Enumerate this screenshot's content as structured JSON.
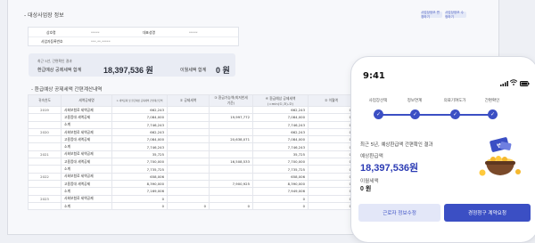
{
  "desktop": {
    "section1_title": "- 대상사업장 정보",
    "header_buttons": [
      "사업장정보 변경하기",
      "사업장정보 수정하기"
    ],
    "info_rows": [
      {
        "k1": "상호명",
        "v1": "*****",
        "k2": "대표성명",
        "v2": "*****"
      },
      {
        "k1": "사업자등록번호",
        "v1": "***-**-*****",
        "k2": "",
        "v2": ""
      }
    ],
    "summary": {
      "caption": "최근 5년, 간편확인 결과",
      "refund_label": "환급예상 공제세액 합계",
      "refund_value": "18,397,536 원",
      "carry_label": "이월세액 합계",
      "carry_value": "0 원"
    },
    "section2_title": "- 환급예상 공제세액 간편계산내역",
    "table": {
      "headers": [
        "귀속연도",
        "세액공제명",
        "① 세액공제 및 환급예상 공제세액 간편계산금액",
        "② 공제세액",
        "③ 환급가능액(최저한세 기준)",
        "④ 환급예상 공제세액 (=min(①,③)-②)",
        "⑤ 이월액",
        "⑥ 간편계산",
        "환급세액"
      ],
      "rows": [
        {
          "year": "2019",
          "name": "사회보험료 세액공제",
          "c1": "662,243",
          "c2": "",
          "c3": "",
          "c4": "662,243",
          "c5": "0",
          "c6": ""
        },
        {
          "year": "",
          "name": "고용증대 세액공제",
          "c1": "7,084,000",
          "c2": "",
          "c3": "19,997,772",
          "c4": "7,084,000",
          "c5": "0",
          "c6": ""
        },
        {
          "year": "",
          "name": "소계",
          "c1": "7,746,243",
          "c2": "",
          "c3": "",
          "c4": "7,746,243",
          "c5": "0",
          "c6": ""
        },
        {
          "year": "2020",
          "name": "사회보험료 세액공제",
          "c1": "662,243",
          "c2": "",
          "c3": "",
          "c4": "662,243",
          "c5": "0",
          "c6": ""
        },
        {
          "year": "",
          "name": "고용증대 세액공제",
          "c1": "7,084,000",
          "c2": "",
          "c3": "20,638,071",
          "c4": "7,084,000",
          "c5": "0",
          "c6": ""
        },
        {
          "year": "",
          "name": "소계",
          "c1": "7,746,243",
          "c2": "",
          "c3": "",
          "c4": "7,746,243",
          "c5": "0",
          "c6": ""
        },
        {
          "year": "2021",
          "name": "사회보험료 세액공제",
          "c1": "35,725",
          "c2": "",
          "c3": "",
          "c4": "35,725",
          "c5": "0",
          "c6": ""
        },
        {
          "year": "",
          "name": "고용증대 세액공제",
          "c1": "7,700,000",
          "c2": "",
          "c3": "16,508,533",
          "c4": "7,700,000",
          "c5": "0",
          "c6": ""
        },
        {
          "year": "",
          "name": "소계",
          "c1": "7,735,725",
          "c2": "",
          "c3": "",
          "c4": "7,735,725",
          "c5": "0",
          "c6": ""
        },
        {
          "year": "2022",
          "name": "사회보험료 세액공제",
          "c1": "658,006",
          "c2": "",
          "c3": "",
          "c4": "658,006",
          "c5": "0",
          "c6": ""
        },
        {
          "year": "",
          "name": "고용증대 세액공제",
          "c1": "8,390,000",
          "c2": "",
          "c3": "7,900,925",
          "c4": "8,390,000",
          "c5": "0",
          "c6": "13,130,000"
        },
        {
          "year": "",
          "name": "소계",
          "c1": "7,169,006",
          "c2": "",
          "c3": "",
          "c4": "7,949,006",
          "c5": "0",
          "c6": "13,130,000"
        },
        {
          "year": "2023",
          "name": "사회보험료 세액공제",
          "c1": "0",
          "c2": "",
          "c3": "",
          "c4": "0",
          "c5": "0",
          "c6": ""
        },
        {
          "year": "",
          "name": "소계",
          "c1": "0",
          "c2": "0",
          "c3": "0",
          "c4": "0",
          "c5": "0",
          "c6": "0"
        }
      ]
    }
  },
  "phone": {
    "time": "9:41",
    "steps": [
      "사업장선택",
      "정보연계",
      "의료기여도가",
      "간편확인"
    ],
    "caption": "최근 5년, 예상환급액 간편확인 결과",
    "refund_label": "예상환급액",
    "refund_value": "18,397,536원",
    "carry_label": "이월세액",
    "carry_value": "0 원",
    "btn_secondary": "근로자 정보수정",
    "btn_primary": "경정청구 계약요청",
    "colors": {
      "accent": "#3b4fc4",
      "accent_light": "#e3e7f8"
    }
  }
}
